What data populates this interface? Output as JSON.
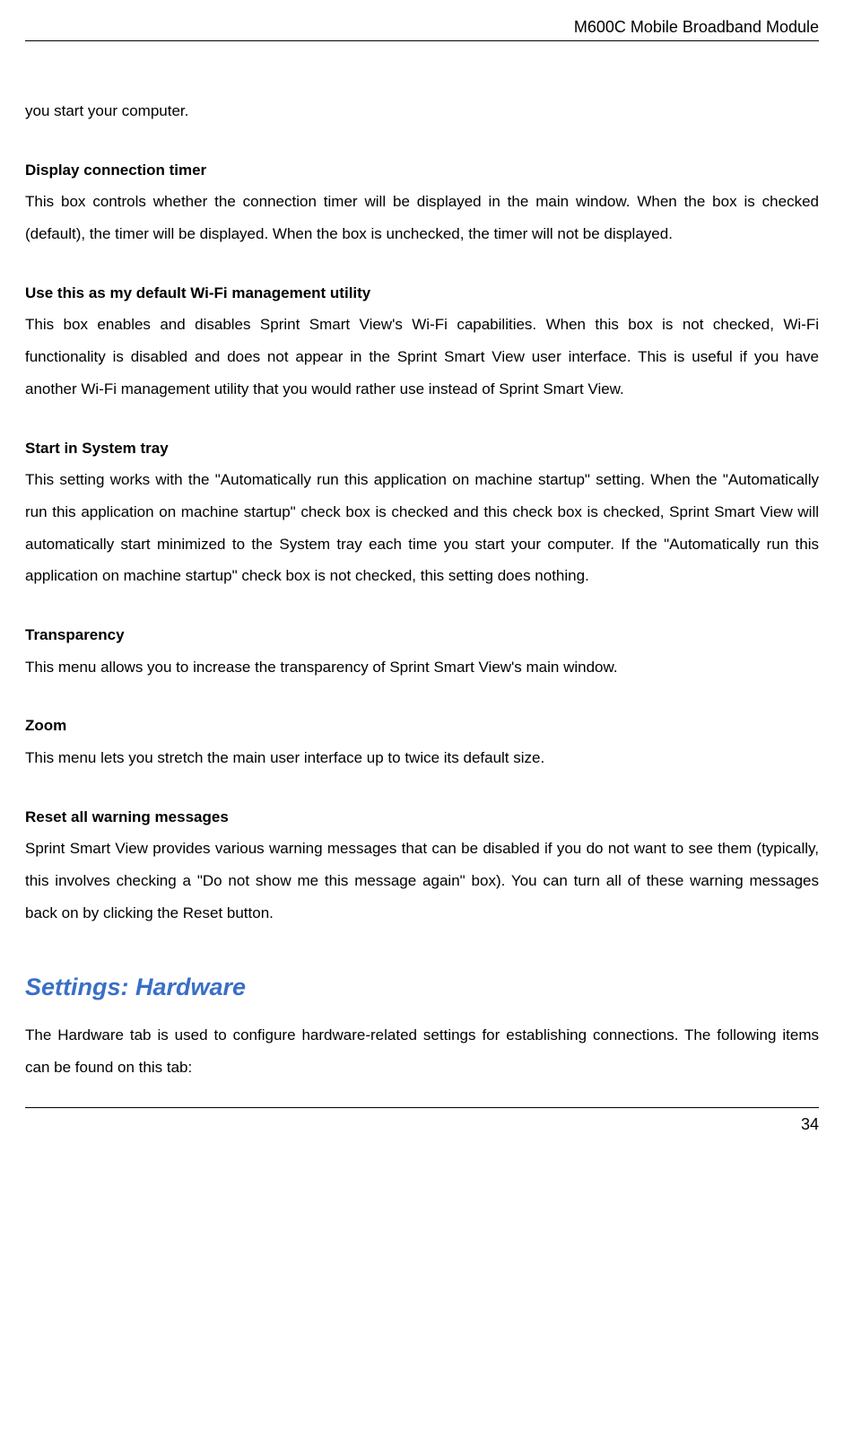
{
  "header": {
    "title": "M600C Mobile Broadband Module"
  },
  "intro_fragment": "you start your computer.",
  "sections": [
    {
      "heading": "Display connection timer",
      "body": "This box controls whether the connection timer will be displayed in the main window. When the box is checked (default), the timer will be displayed. When the box is unchecked, the timer will not be displayed."
    },
    {
      "heading": "Use this as my default Wi-Fi management utility",
      "body": "This box enables and disables Sprint Smart View's Wi-Fi capabilities. When this box is not checked, Wi-Fi functionality is disabled and does not appear in the Sprint Smart View user interface. This is useful if you have another Wi-Fi management utility that you would rather use instead of Sprint Smart View."
    },
    {
      "heading": "Start in System tray",
      "body": "This setting works with the \"Automatically run this application on machine startup\" setting. When the \"Automatically run this application on machine startup\" check box is checked and this check box is checked, Sprint Smart View will automatically start minimized to the System tray each time you start your computer. If the \"Automatically run this application on machine startup\" check box is not checked, this setting does nothing."
    },
    {
      "heading": "Transparency",
      "body": "This menu allows you to increase the transparency of Sprint Smart View's main window."
    },
    {
      "heading": "Zoom",
      "body": "This menu lets you stretch the main user interface up to twice its default size."
    },
    {
      "heading": "Reset all warning messages",
      "body": "Sprint Smart View provides various warning messages that can be disabled if you do not want to see them (typically, this involves checking a \"Do not show me this message again\" box). You can turn all of these warning messages back on by clicking the Reset button."
    }
  ],
  "chapter": {
    "title": "Settings: Hardware",
    "intro": "The Hardware tab is used to configure hardware-related settings for establishing connections. The following items can be found on this tab:"
  },
  "footer": {
    "page_number": "34"
  }
}
